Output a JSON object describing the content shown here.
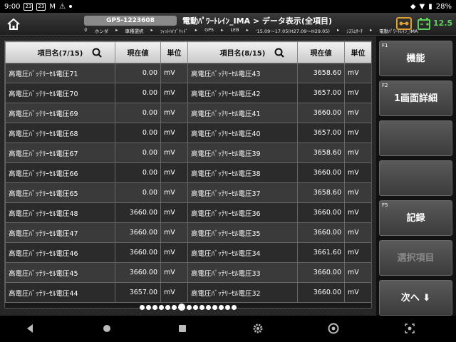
{
  "status": {
    "time": "9:00",
    "icons": [
      "23",
      "23",
      "M"
    ],
    "battery": "28%"
  },
  "header": {
    "device_id": "GP5-1223608",
    "title": "電動ﾊﾟﾜｰﾄﾚｲﾝ_IMA > データ表示(全項目)",
    "breadcrumbs": [
      "ホンダ",
      "車種選択",
      "ﾌｨｯﾄﾊｲﾌﾞﾘｯﾄﾞ",
      "GP5",
      "LEB",
      "'15.09～17.05(H27.09～H29.05)",
      "ｼｽﾃﾑｻｰﾁ",
      "電動ﾊﾟﾜｰﾄﾚｲﾝ_IMA"
    ],
    "voltage": "12.5"
  },
  "table": {
    "left_header": "項目名(7/15)",
    "right_header": "項目名(8/15)",
    "value_header": "現在値",
    "unit_header": "単位",
    "rows": [
      [
        "高電圧ﾊﾞｯﾃﾘｰｾﾙ電圧71",
        "0.00",
        "mV",
        "高電圧ﾊﾞｯﾃﾘｰｾﾙ電圧43",
        "3658.60",
        "mV"
      ],
      [
        "高電圧ﾊﾞｯﾃﾘｰｾﾙ電圧70",
        "0.00",
        "mV",
        "高電圧ﾊﾞｯﾃﾘｰｾﾙ電圧42",
        "3657.00",
        "mV"
      ],
      [
        "高電圧ﾊﾞｯﾃﾘｰｾﾙ電圧69",
        "0.00",
        "mV",
        "高電圧ﾊﾞｯﾃﾘｰｾﾙ電圧41",
        "3660.00",
        "mV"
      ],
      [
        "高電圧ﾊﾞｯﾃﾘｰｾﾙ電圧68",
        "0.00",
        "mV",
        "高電圧ﾊﾞｯﾃﾘｰｾﾙ電圧40",
        "3657.00",
        "mV"
      ],
      [
        "高電圧ﾊﾞｯﾃﾘｰｾﾙ電圧67",
        "0.00",
        "mV",
        "高電圧ﾊﾞｯﾃﾘｰｾﾙ電圧39",
        "3658.60",
        "mV"
      ],
      [
        "高電圧ﾊﾞｯﾃﾘｰｾﾙ電圧66",
        "0.00",
        "mV",
        "高電圧ﾊﾞｯﾃﾘｰｾﾙ電圧38",
        "3660.00",
        "mV"
      ],
      [
        "高電圧ﾊﾞｯﾃﾘｰｾﾙ電圧65",
        "0.00",
        "mV",
        "高電圧ﾊﾞｯﾃﾘｰｾﾙ電圧37",
        "3658.60",
        "mV"
      ],
      [
        "高電圧ﾊﾞｯﾃﾘｰｾﾙ電圧48",
        "3660.00",
        "mV",
        "高電圧ﾊﾞｯﾃﾘｰｾﾙ電圧36",
        "3660.00",
        "mV"
      ],
      [
        "高電圧ﾊﾞｯﾃﾘｰｾﾙ電圧47",
        "3660.00",
        "mV",
        "高電圧ﾊﾞｯﾃﾘｰｾﾙ電圧35",
        "3660.00",
        "mV"
      ],
      [
        "高電圧ﾊﾞｯﾃﾘｰｾﾙ電圧46",
        "3660.00",
        "mV",
        "高電圧ﾊﾞｯﾃﾘｰｾﾙ電圧34",
        "3661.60",
        "mV"
      ],
      [
        "高電圧ﾊﾞｯﾃﾘｰｾﾙ電圧45",
        "3660.00",
        "mV",
        "高電圧ﾊﾞｯﾃﾘｰｾﾙ電圧33",
        "3660.00",
        "mV"
      ],
      [
        "高電圧ﾊﾞｯﾃﾘｰｾﾙ電圧44",
        "3657.00",
        "mV",
        "高電圧ﾊﾞｯﾃﾘｰｾﾙ電圧32",
        "3660.00",
        "mV"
      ]
    ]
  },
  "pager": {
    "count": 15,
    "active_index": 6
  },
  "side_buttons": [
    {
      "fkey": "F1",
      "label": "機能",
      "enabled": true
    },
    {
      "fkey": "F2",
      "label": "1画面詳細",
      "enabled": true
    },
    {
      "fkey": "",
      "label": "",
      "enabled": true
    },
    {
      "fkey": "",
      "label": "",
      "enabled": true
    },
    {
      "fkey": "F5",
      "label": "記録",
      "enabled": true
    },
    {
      "fkey": "",
      "label": "選択項目",
      "enabled": false
    },
    {
      "fkey": "",
      "label": "次へ ⬇",
      "enabled": true
    }
  ],
  "colors": {
    "voltage": "#5bd15b",
    "accent": "#e0a030"
  }
}
